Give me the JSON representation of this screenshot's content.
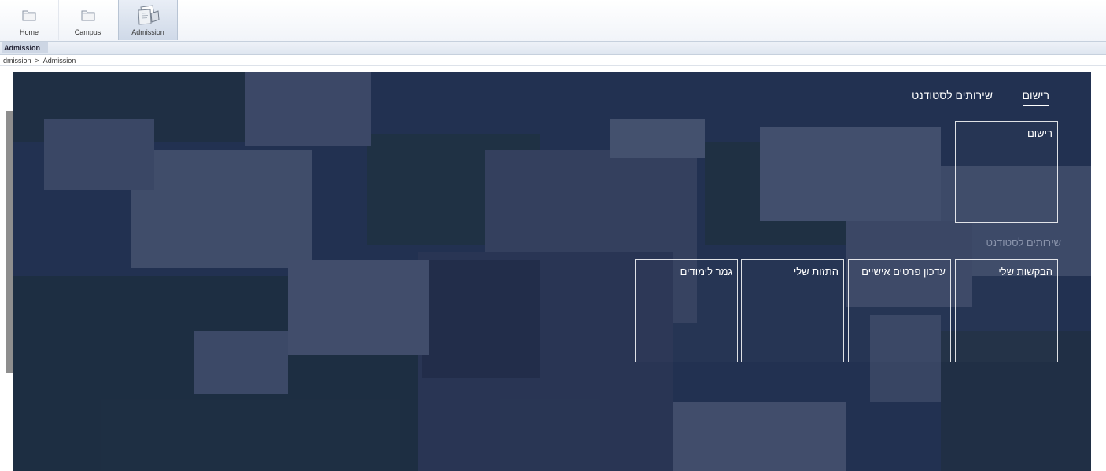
{
  "nav": {
    "tabs": [
      {
        "label": "Home",
        "icon": "folder-icon"
      },
      {
        "label": "Campus",
        "icon": "folder-icon"
      },
      {
        "label": "Admission",
        "icon": "documents-icon",
        "active": true
      }
    ]
  },
  "subnav": {
    "active_tab": "Admission"
  },
  "breadcrumb": {
    "items": [
      "dmission",
      "Admission"
    ],
    "separator": ">"
  },
  "portal": {
    "tabs": [
      "רישום",
      "שירותים לסטודנט"
    ],
    "registration_tile": "רישום",
    "services_label": "שירותים לסטודנט",
    "service_tiles": [
      "הבקשות שלי",
      "עדכון פרטים אישיים",
      "התזות שלי",
      "גמר לימודים"
    ]
  },
  "colors": {
    "overlay": "#1d2c54",
    "tile_border": "#ffffff",
    "nav_active": "#cfd9e8"
  }
}
